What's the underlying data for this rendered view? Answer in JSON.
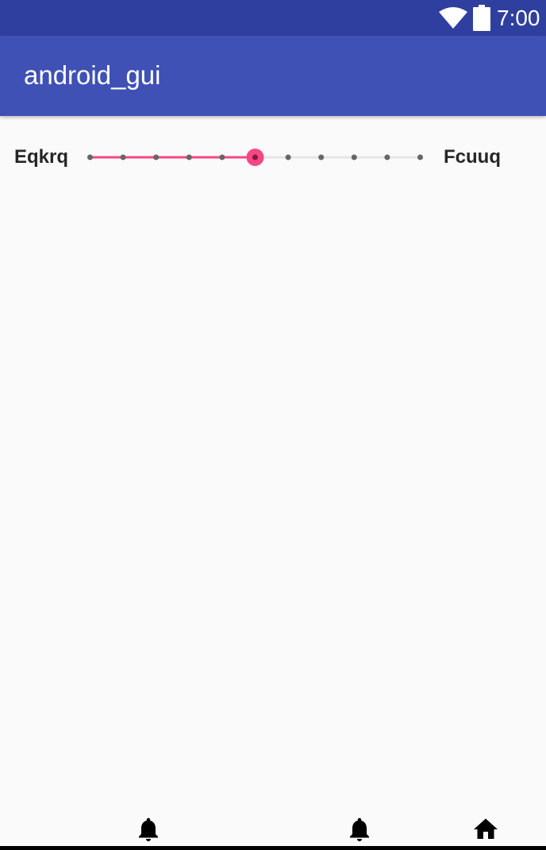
{
  "status_bar": {
    "time": "7:00",
    "icons": [
      "wifi-icon",
      "battery-icon"
    ],
    "color": "#2f3f9f"
  },
  "app_bar": {
    "title": "android_gui",
    "color": "#3f51b5"
  },
  "seekbar": {
    "min_label": "Eqkrq",
    "max_label": "Fcuuq",
    "max": 10,
    "progress": 5,
    "accent_color": "#f54785",
    "track_color": "#e6e6e6",
    "tick_color": "#666666"
  },
  "nav_bar": {
    "buttons": [
      "bell-icon",
      "bell-icon",
      "home-icon"
    ]
  }
}
